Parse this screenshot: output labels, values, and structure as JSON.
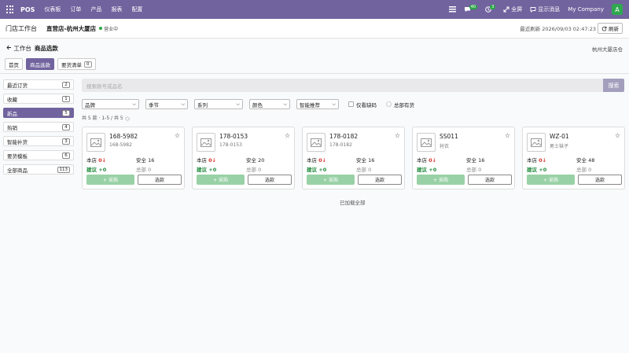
{
  "topbar": {
    "brand": "POS",
    "menu": [
      "仪表板",
      "订单",
      "产品",
      "报表",
      "配置"
    ],
    "msg_count": "40",
    "activity_count": "3",
    "fullscreen": "全屏",
    "show_msg": "显示消息",
    "company": "My Company",
    "avatar": "A",
    "color": "#71639e"
  },
  "header": {
    "title": "门店工作台",
    "store": "直营店-杭州大厦店",
    "status": "营业中",
    "last_refresh": "最近刷新 2026/09/03 02:47:23",
    "refresh_btn": "刷新"
  },
  "breadcrumb": {
    "back": "工作台",
    "current": "商品选款",
    "store_right": "杭州大厦店仓"
  },
  "tabs": [
    {
      "label": "首页"
    },
    {
      "label": "商品选款"
    },
    {
      "label": "要货清单",
      "count": "0"
    }
  ],
  "sidebar": [
    {
      "label": "最近订货",
      "count": "2"
    },
    {
      "label": "收藏",
      "count": "1"
    },
    {
      "label": "新品",
      "count": "5"
    },
    {
      "label": "热销",
      "count": "4"
    },
    {
      "label": "智能补货",
      "count": "3"
    },
    {
      "label": "要货模板",
      "count": "6"
    },
    {
      "label": "全部商品",
      "count": "113"
    }
  ],
  "search": {
    "placeholder": "搜索款号或品名",
    "button": "搜索"
  },
  "filters": {
    "brand": "品牌",
    "season": "季节",
    "series": "系列",
    "color": "颜色",
    "smart": "智能推荐",
    "only_short": "仅看缺码",
    "all_stock": "总部有货"
  },
  "count_line": "共 5 款 · 1-5 / 共 5",
  "cards": [
    {
      "code": "168-5982",
      "sub": "168-5982",
      "store_label": "本店",
      "store_val": "0",
      "safe": "安全 16",
      "suggest": "建议 +0",
      "hq": "总部 0",
      "btn_add": "+ 采购",
      "btn_pick": "选款"
    },
    {
      "code": "178-0153",
      "sub": "178-0153",
      "store_label": "本店",
      "store_val": "0",
      "safe": "安全 20",
      "suggest": "建议 +0",
      "hq": "总部 0",
      "btn_add": "+ 采购",
      "btn_pick": "选款"
    },
    {
      "code": "178-0182",
      "sub": "178-0182",
      "store_label": "本店",
      "store_val": "0",
      "safe": "安全 16",
      "suggest": "建议 +0",
      "hq": "总部 0",
      "btn_add": "+ 采购",
      "btn_pick": "选款"
    },
    {
      "code": "SS011",
      "sub": "衬衣",
      "store_label": "本店",
      "store_val": "0",
      "safe": "安全 16",
      "suggest": "建议 +0",
      "hq": "总部 0",
      "btn_add": "+ 采购",
      "btn_pick": "选款"
    },
    {
      "code": "WZ-01",
      "sub": "男士袜子",
      "store_label": "本店",
      "store_val": "0",
      "safe": "安全 48",
      "suggest": "建议 +0",
      "hq": "总部 0",
      "btn_add": "+ 采购",
      "btn_pick": "选款"
    }
  ],
  "loaded_all": "已加载全部"
}
